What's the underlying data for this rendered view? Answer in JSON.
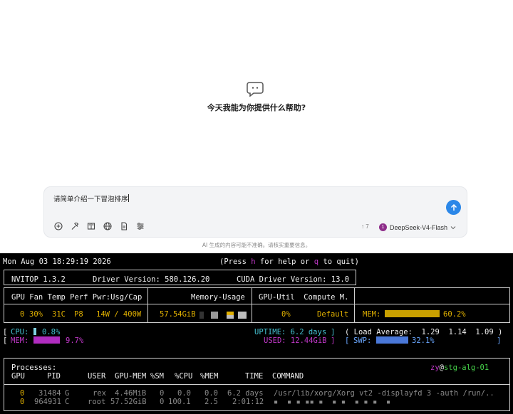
{
  "chat": {
    "welcome": "今天我能为你提供什么帮助?",
    "input_value": "请简单介绍一下冒泡排序",
    "message_count": "↑ 7",
    "model_badge": "1",
    "model_name": "DeepSeek-V4-Flash",
    "disclaimer": "AI 生成的内容可能不准确。请核实重要信息。",
    "tools": [
      "plus-circle-icon",
      "hammer-icon",
      "book-icon",
      "globe-icon",
      "document-icon",
      "sliders-icon"
    ],
    "send_color": "#2b87e8"
  },
  "terminal": {
    "datetime": "Mon Aug 03 18:29:19 2026",
    "hint_pre": "(Press ",
    "hint_h": "h",
    "hint_mid": " for help or ",
    "hint_q": "q",
    "hint_post": " to quit)",
    "nvitop_version": "NVITOP 1.3.2",
    "driver_version": "Driver Version: 580.126.20",
    "cuda_version": "CUDA Driver Version: 13.0",
    "gpu_header": "GPU Fan Temp Perf Pwr:Usg/Cap",
    "mem_header": "Memory-Usage",
    "util_header": "GPU-Util  Compute M.",
    "gpu": {
      "index": "0",
      "fan": "30%",
      "temp": "31C",
      "perf": "P8",
      "power": "14W / 400W",
      "memory": "57.54GiB",
      "util": "0%",
      "compute_mode": "Default",
      "mem_label": "MEM:",
      "mem_percent": "60.2%",
      "mem_fraction": 0.602
    },
    "host": {
      "cpu_label": "CPU:",
      "cpu_percent": "0.8%",
      "cpu_fraction": 0.008,
      "mem_label": "MEM:",
      "mem_percent": "9.7%",
      "mem_fraction": 0.097,
      "uptime": "UPTIME: 6.2 days",
      "load_label": "Load Average:",
      "load_1": "1.29",
      "load_5": "1.14",
      "load_15": "1.09",
      "used": "USED: 12.44GiB",
      "swp_label": "SWP:",
      "swp_percent": "32.1%",
      "swp_fraction": 0.321
    },
    "processes": {
      "title": "Processes:",
      "user_host_user": "zy",
      "user_host_at": "@",
      "user_host_host": "stg-alg-01",
      "headers": [
        "GPU",
        "PID",
        "USER",
        "GPU-MEM",
        "%SM",
        "%CPU",
        "%MEM",
        "TIME",
        "COMMAND"
      ],
      "rows": [
        {
          "gpu": "0",
          "pid": "31484",
          "type": "G",
          "user": "rex",
          "gpu_mem": "4.46MiB",
          "sm": "0",
          "cpu": "0.0",
          "mem": "0.0",
          "time": "6.2 days",
          "command": "/usr/lib/xorg/Xorg vt2 -displayfd 3 -auth /run/.."
        },
        {
          "gpu": "0",
          "pid": "964931",
          "type": "C",
          "user": "root",
          "gpu_mem": "57.52GiB",
          "sm": "0",
          "cpu": "100.1",
          "mem": "2.5",
          "time": "2:01:12",
          "command": ""
        }
      ]
    }
  }
}
